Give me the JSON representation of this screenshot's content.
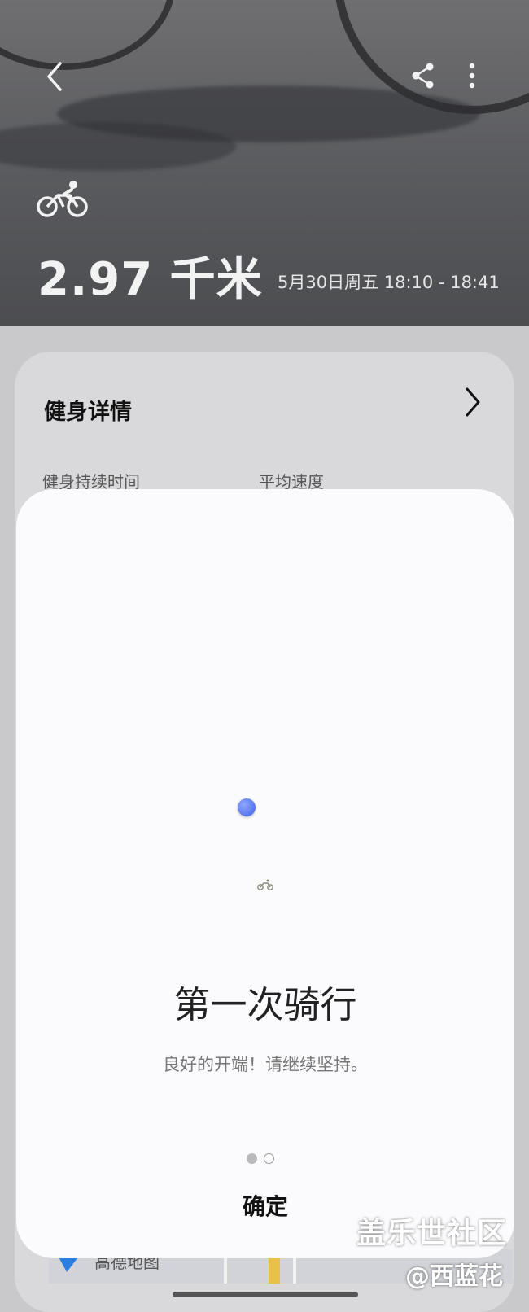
{
  "header": {
    "distance": "2.97 千米",
    "datetime": "5月30日周五 18:10 - 18:41",
    "back_icon": "back-icon",
    "share_icon": "share-icon",
    "more_icon": "more-icon",
    "activity_icon": "bicycle-icon"
  },
  "detail": {
    "title": "健身详情",
    "duration_label": "健身持续时间",
    "speed_label": "平均速度",
    "map_label": "高德地图"
  },
  "modal": {
    "title": "第一次骑行",
    "subtitle": "良好的开端！请继续坚持。",
    "confirm_label": "确定",
    "page_count": 2,
    "active_page": 1
  },
  "watermark": {
    "line1": "盖乐世社区",
    "line2": "@西蓝花"
  },
  "colors": {
    "modal_bg": "#fbfbfe",
    "location_dot": "#3f63e6",
    "scrim": "#c9c9cb"
  }
}
